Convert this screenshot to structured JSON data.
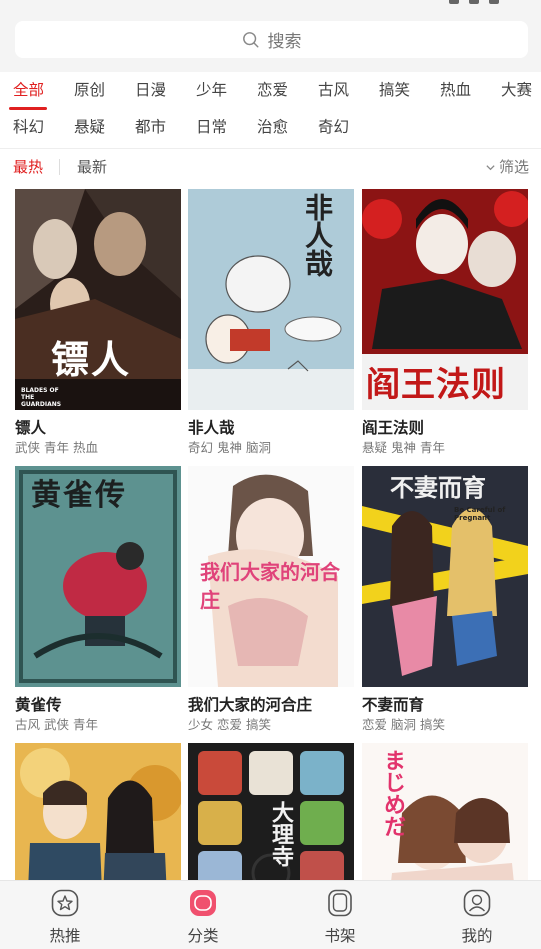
{
  "search": {
    "placeholder": "搜索"
  },
  "categories": {
    "row1": [
      "全部",
      "原创",
      "日漫",
      "少年",
      "恋爱",
      "古风",
      "搞笑",
      "热血",
      "大赛"
    ],
    "row2": [
      "科幻",
      "悬疑",
      "都市",
      "日常",
      "治愈",
      "奇幻"
    ],
    "active": "全部"
  },
  "sort": {
    "hot": "最热",
    "new": "最新",
    "filter": "筛选",
    "active": "最热"
  },
  "comics": [
    {
      "title": "镖人",
      "tags": "武侠 青年 热血",
      "cover_text": "镖人",
      "cover_sub": "BLADES OF THE GUARDIANS"
    },
    {
      "title": "非人哉",
      "tags": "奇幻 鬼神 脑洞",
      "cover_text": "非人哉"
    },
    {
      "title": "阎王法则",
      "tags": "悬疑 鬼神 青年",
      "cover_text": "阎王法则"
    },
    {
      "title": "黄雀传",
      "tags": "古风 武侠 青年",
      "cover_text": "黄雀传"
    },
    {
      "title": "我们大家的河合庄",
      "tags": "少女 恋爱 搞笑",
      "cover_text": "我们大家的河合庄"
    },
    {
      "title": "不妻而育",
      "tags": "恋爱 脑洞 搞笑",
      "cover_text": "不妻而育",
      "cover_sub": "Be Careful of Pregnant"
    },
    {
      "title": "",
      "tags": ""
    },
    {
      "title": "",
      "tags": "",
      "cover_text": "大理寺"
    },
    {
      "title": "",
      "tags": "",
      "cover_text": "まじめだ"
    }
  ],
  "tabbar": [
    {
      "label": "热推",
      "icon": "star-icon"
    },
    {
      "label": "分类",
      "icon": "category-icon",
      "active": true
    },
    {
      "label": "书架",
      "icon": "bookshelf-icon"
    },
    {
      "label": "我的",
      "icon": "user-icon"
    }
  ],
  "colors": {
    "accent": "#e02020",
    "tab_active": "#f0506e"
  }
}
